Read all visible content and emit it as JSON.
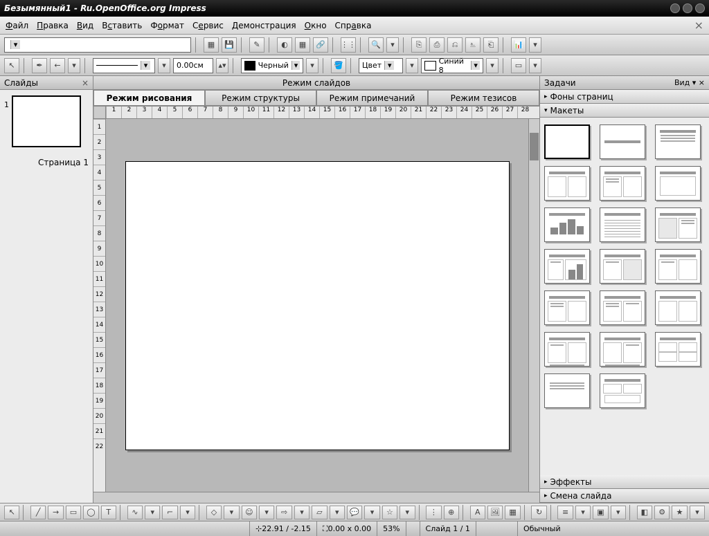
{
  "title": "Безымянный1 - Ru.OpenOffice.org Impress",
  "menu": {
    "file": "Файл",
    "edit": "Правка",
    "view": "Вид",
    "insert": "Вставить",
    "format": "Формат",
    "tools": "Сервис",
    "slideshow": "Демонстрация",
    "window": "Окно",
    "help": "Справка"
  },
  "line": {
    "width": "0.00см",
    "color": "Черный",
    "fill_label": "Цвет",
    "fill_color": "Синий 8"
  },
  "slides": {
    "title": "Слайды",
    "page_label": "Страница 1",
    "num": "1"
  },
  "center": {
    "mode": "Режим слайдов",
    "tab_draw": "Режим рисования",
    "tab_outline": "Режим структуры",
    "tab_notes": "Режим примечаний",
    "tab_handout": "Режим тезисов"
  },
  "ruler": {
    "h": [
      "1",
      "2",
      "3",
      "4",
      "5",
      "6",
      "7",
      "8",
      "9",
      "10",
      "11",
      "12",
      "13",
      "14",
      "15",
      "16",
      "17",
      "18",
      "19",
      "20",
      "21",
      "22",
      "23",
      "24",
      "25",
      "26",
      "27",
      "28"
    ],
    "v": [
      "1",
      "2",
      "3",
      "4",
      "5",
      "6",
      "7",
      "8",
      "9",
      "10",
      "11",
      "12",
      "13",
      "14",
      "15",
      "16",
      "17",
      "18",
      "19",
      "20",
      "21",
      "22"
    ]
  },
  "tasks": {
    "title": "Задачи",
    "view": "Вид",
    "masters": "Фоны страниц",
    "layouts": "Макеты",
    "effects": "Эффекты",
    "transition": "Смена слайда"
  },
  "status": {
    "pos": "22.91 / -2.15",
    "size": "0.00 x 0.00",
    "zoom": "53%",
    "slide": "Слайд 1 / 1",
    "mode": "Обычный"
  }
}
